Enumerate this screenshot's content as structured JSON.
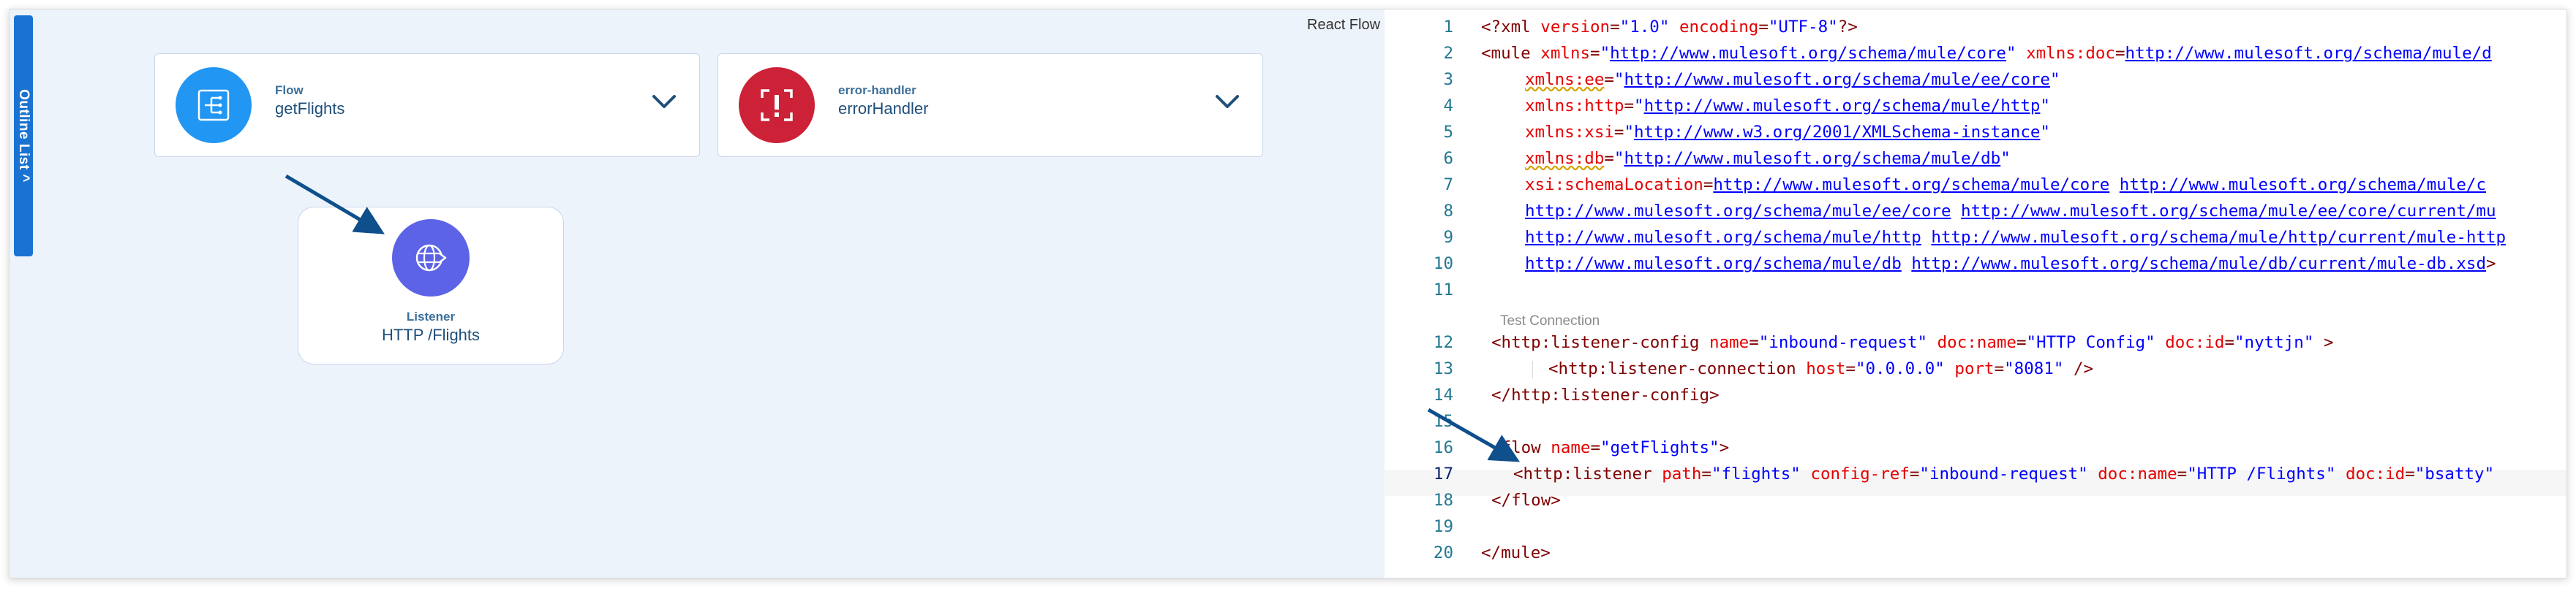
{
  "canvas": {
    "outline_tab_label": "Outline List ^",
    "react_flow_label": "React Flow",
    "flow_node": {
      "type": "Flow",
      "name": "getFlights",
      "color": "#2196f3",
      "icon": "flow-icon"
    },
    "error_node": {
      "type": "error-handler",
      "name": "errorHandler",
      "color": "#cc2136",
      "icon": "error-icon"
    },
    "listener_node": {
      "type": "Listener",
      "name": "HTTP /Flights",
      "color": "#5c63e6",
      "icon": "globe-icon"
    },
    "arrow_color": "#0e4f8c"
  },
  "editor": {
    "code_lens": "Test Connection",
    "lines": [
      {
        "n": "1",
        "text": "<?xml version=\"1.0\" encoding=\"UTF-8\"?>"
      },
      {
        "n": "2",
        "text": "<mule xmlns=\"http://www.mulesoft.org/schema/mule/core\" xmlns:doc=\"http://www.mulesoft.org/schema/mule/d"
      },
      {
        "n": "3",
        "text": "xmlns:ee=\"http://www.mulesoft.org/schema/mule/ee/core\""
      },
      {
        "n": "4",
        "text": "xmlns:http=\"http://www.mulesoft.org/schema/mule/http\""
      },
      {
        "n": "5",
        "text": "xmlns:xsi=\"http://www.w3.org/2001/XMLSchema-instance\""
      },
      {
        "n": "6",
        "text": "xmlns:db=\"http://www.mulesoft.org/schema/mule/db\""
      },
      {
        "n": "7",
        "text": "xsi:schemaLocation=\"http://www.mulesoft.org/schema/mule/core http://www.mulesoft.org/schema/mule/c"
      },
      {
        "n": "8",
        "text": "http://www.mulesoft.org/schema/mule/ee/core http://www.mulesoft.org/schema/mule/ee/core/current/mu"
      },
      {
        "n": "9",
        "text": "http://www.mulesoft.org/schema/mule/http http://www.mulesoft.org/schema/mule/http/current/mule-http"
      },
      {
        "n": "10",
        "text": "http://www.mulesoft.org/schema/mule/db http://www.mulesoft.org/schema/mule/db/current/mule-db.xsd\">"
      },
      {
        "n": "11",
        "text": ""
      },
      {
        "n": "12",
        "text": "<http:listener-config name=\"inbound-request\" doc:name=\"HTTP Config\" doc:id=\"nyttjn\" >"
      },
      {
        "n": "13",
        "text": "<http:listener-connection host=\"0.0.0.0\" port=\"8081\" />"
      },
      {
        "n": "14",
        "text": "</http:listener-config>"
      },
      {
        "n": "15",
        "text": ""
      },
      {
        "n": "16",
        "text": "<flow name=\"getFlights\">"
      },
      {
        "n": "17",
        "text": "<http:listener path=\"flights\" config-ref=\"inbound-request\" doc:name=\"HTTP /Flights\" doc:id=\"bsatty\""
      },
      {
        "n": "18",
        "text": "</flow>"
      },
      {
        "n": "19",
        "text": ""
      },
      {
        "n": "20",
        "text": "</mule>"
      }
    ]
  }
}
